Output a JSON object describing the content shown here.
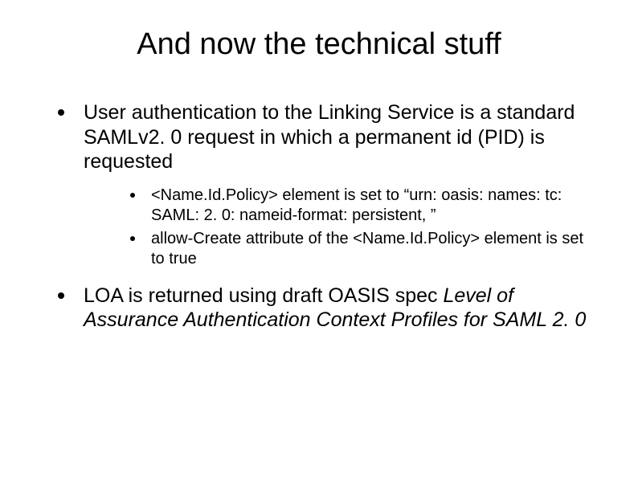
{
  "title": "And now the technical stuff",
  "bullets": {
    "b1": "User authentication to the Linking Service is a standard SAMLv2. 0 request in which a permanent id (PID) is requested",
    "b1_sub1": "<Name.Id.Policy> element is set to “urn: oasis: names: tc: SAML: 2. 0: nameid-format: persistent, ”",
    "b1_sub2": "allow-Create attribute of the <Name.Id.Policy> element is set to true",
    "b2_pre": "LOA is returned using draft OASIS spec ",
    "b2_italic": "Level of Assurance Authentication Context Profiles for SAML 2. 0"
  }
}
